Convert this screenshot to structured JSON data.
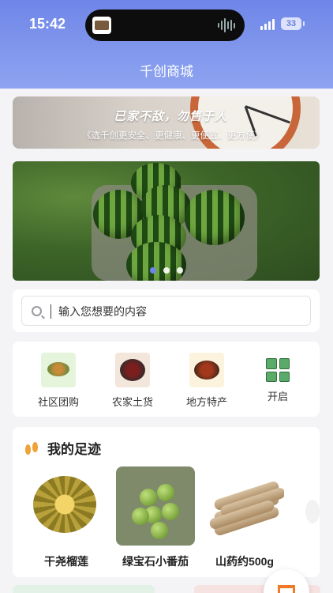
{
  "status_bar": {
    "time": "15:42",
    "battery": "33"
  },
  "header": {
    "title": "千创商城"
  },
  "promo_banner": {
    "headline": "已家不敌，勿售于人",
    "subtitle": "《选千创更安全、更健康、更便宜、更方便》"
  },
  "carousel": {
    "image_icon": "watermelon-image",
    "slide_count": 3,
    "active_slide": 1
  },
  "search": {
    "placeholder": "输入您想要的内容"
  },
  "quick_nav": [
    {
      "label": "社区团购",
      "icon": "community-group-buy-icon"
    },
    {
      "label": "农家土货",
      "icon": "farm-goods-icon"
    },
    {
      "label": "地方特产",
      "icon": "local-specialty-icon"
    },
    {
      "label": "开启",
      "icon": "grid-icon"
    }
  ],
  "footprints": {
    "title": "我的足迹",
    "products": [
      {
        "name": "干尧榴莲",
        "image": "durian-image"
      },
      {
        "name": "绿宝石小番茄",
        "image": "green-tomato-image"
      },
      {
        "name": "山药约500g",
        "image": "yam-image"
      }
    ]
  },
  "colors": {
    "header_gradient_top": "#6f86e8",
    "accent": "#f07a28",
    "active_dot": "#6f86e8"
  }
}
